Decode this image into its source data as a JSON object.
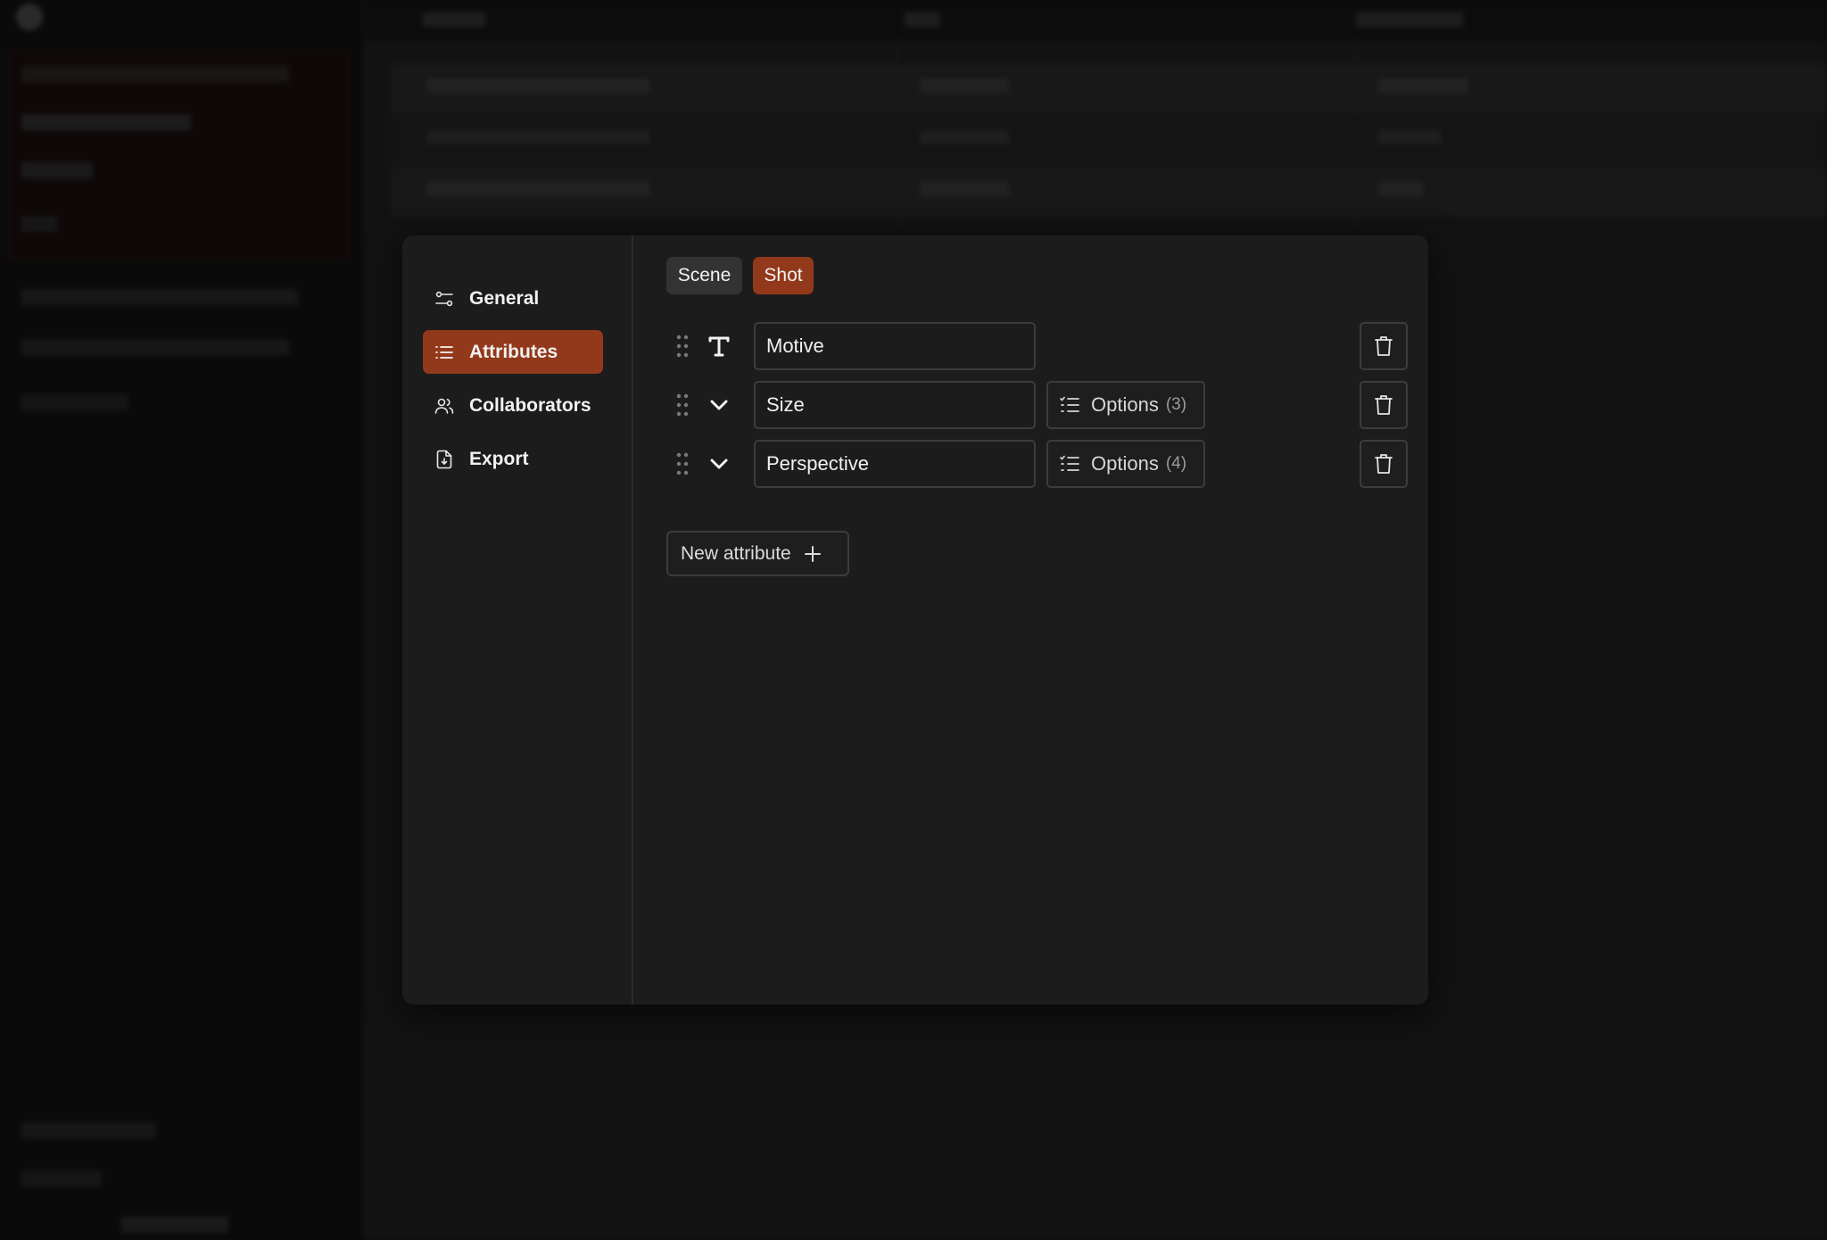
{
  "modal": {
    "nav": [
      {
        "label": "General",
        "icon": "sliders-icon",
        "active": false
      },
      {
        "label": "Attributes",
        "icon": "list-icon",
        "active": true
      },
      {
        "label": "Collaborators",
        "icon": "users-icon",
        "active": false
      },
      {
        "label": "Export",
        "icon": "file-export-icon",
        "active": false
      }
    ],
    "tabs": [
      {
        "label": "Scene",
        "active": false
      },
      {
        "label": "Shot",
        "active": true
      }
    ],
    "attributes": [
      {
        "type_icon": "text-type-icon",
        "name": "Motive",
        "has_options": false
      },
      {
        "type_icon": "chevron-down-icon",
        "name": "Size",
        "has_options": true,
        "options_label": "Options",
        "options_count": "(3)"
      },
      {
        "type_icon": "chevron-down-icon",
        "name": "Perspective",
        "has_options": true,
        "options_label": "Options",
        "options_count": "(4)"
      }
    ],
    "new_attribute_label": "New attribute",
    "help_label": "?"
  },
  "colors": {
    "accent": "#93391b",
    "modal_bg": "#1c1c1c",
    "page_bg": "#0b0b0b"
  }
}
